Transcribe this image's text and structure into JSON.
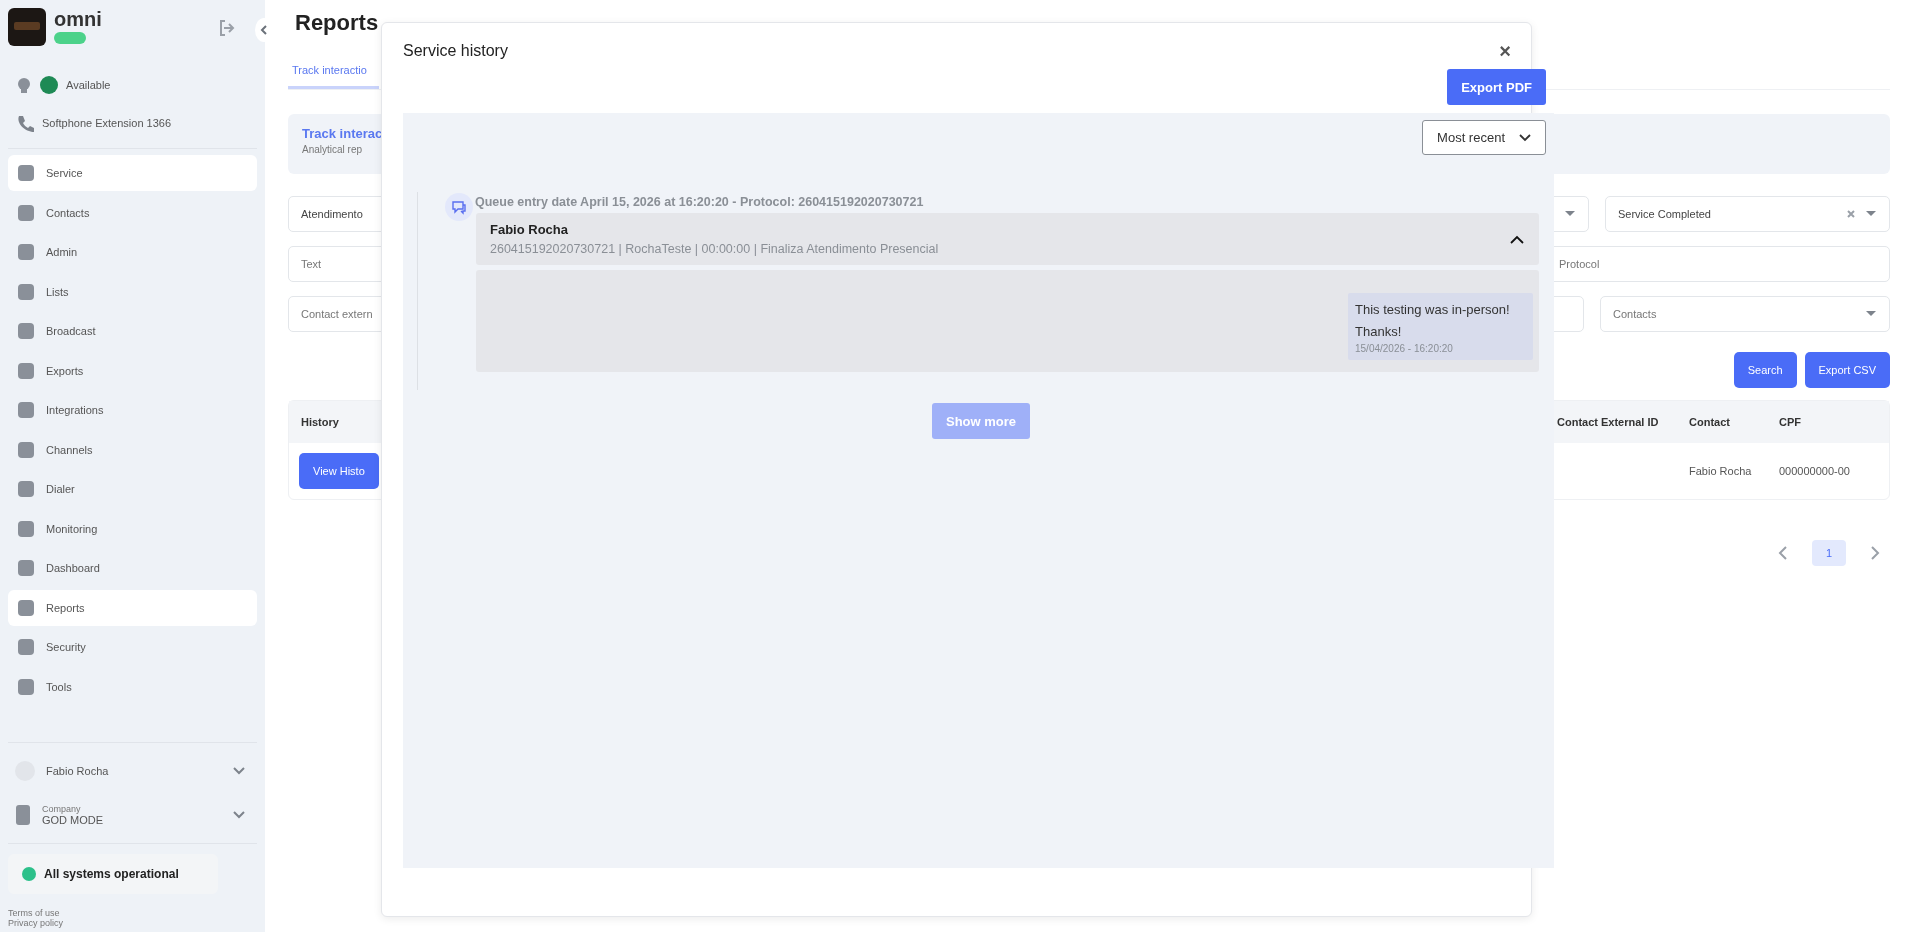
{
  "sidebar": {
    "brand": "omni",
    "status": "Available",
    "softphone": "Softphone Extension 1366",
    "items": [
      {
        "label": "Service",
        "selected": true
      },
      {
        "label": "Contacts",
        "selected": false
      },
      {
        "label": "Admin",
        "selected": false
      },
      {
        "label": "Lists",
        "selected": false
      },
      {
        "label": "Broadcast",
        "selected": false
      },
      {
        "label": "Exports",
        "selected": false
      },
      {
        "label": "Integrations",
        "selected": false
      },
      {
        "label": "Channels",
        "selected": false
      },
      {
        "label": "Dialer",
        "selected": false
      },
      {
        "label": "Monitoring",
        "selected": false
      },
      {
        "label": "Dashboard",
        "selected": false
      },
      {
        "label": "Reports",
        "selected": true
      },
      {
        "label": "Security",
        "selected": false
      },
      {
        "label": "Tools",
        "selected": false
      }
    ],
    "user": "Fabio Rocha",
    "company_label": "Company",
    "company": "GOD MODE",
    "system_status": "All systems operational",
    "links": [
      "Terms of use",
      "Privacy policy"
    ]
  },
  "page": {
    "title": "Reports",
    "tab": "Track interactio",
    "card_title": "Track interac",
    "card_subtitle": "Analytical rep",
    "filters": {
      "left": [
        "Atendimento",
        "Text",
        "Contact extern"
      ],
      "status": "Service Completed",
      "protocol": "Protocol",
      "contacts": "Contacts"
    },
    "buttons": [
      "Search",
      "Export CSV"
    ],
    "table": {
      "columns": [
        "History",
        "Contact External ID",
        "Contact",
        "CPF"
      ],
      "row": {
        "action": "View Histo",
        "contact": "Fabio Rocha",
        "cpf": "000000000-00"
      }
    },
    "pagination": {
      "page": "1"
    }
  },
  "modal": {
    "title": "Service history",
    "close": "×",
    "export": "Export PDF",
    "sort": "Most recent",
    "entries": [
      {
        "heading": "Queue entry date April 15, 2026 at 16:20:20 - Protocol: 260415192020730721",
        "name": "Fabio Rocha",
        "details": "260415192020730721 | RochaTeste | 00:00:00 | Finaliza Atendimento Presencial",
        "expanded": true,
        "messages": [
          {
            "text": "This testing was in-person! Thanks!",
            "time": "15/04/2026 - 16:20:20"
          }
        ]
      }
    ],
    "show_more": "Show more"
  }
}
